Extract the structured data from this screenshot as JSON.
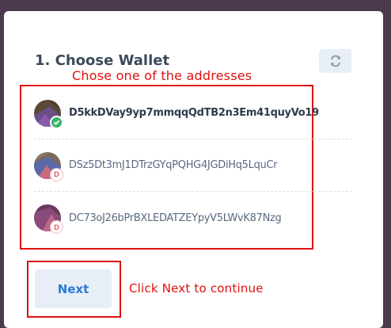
{
  "step": {
    "title": "1. Choose Wallet"
  },
  "annotations": {
    "choose_hint": "Chose one of the addresses",
    "next_hint": "Click Next to continue"
  },
  "wallets": [
    {
      "address": "D5kkDVay9yp7mmqqQdTB2n3Em41quyVo19",
      "selected": true,
      "badge": "check-icon"
    },
    {
      "address": "DSz5Dt3mJ1DTrzGYqPQHG4JGDiHq5LquCr",
      "selected": false,
      "badge": "D"
    },
    {
      "address": "DC73oJ26bPrBXLEDATZEYpyV5LWvK87Nzg",
      "selected": false,
      "badge": "D"
    }
  ],
  "buttons": {
    "next": "Next"
  },
  "colors": {
    "accent": "#2d7ad6",
    "annotation": "#e01010",
    "selected_badge": "#34b36b",
    "background": "#4b3a4d"
  }
}
